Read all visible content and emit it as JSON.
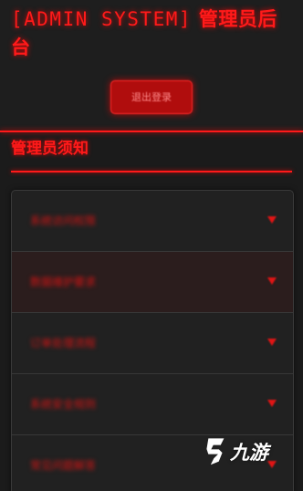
{
  "header": {
    "title_prefix": "[ADMIN SYSTEM]",
    "title_suffix": "管理员后台",
    "logout_label": "退出登录"
  },
  "notice": {
    "section_title": "管理员须知",
    "items": [
      {
        "label": "系统访问权限"
      },
      {
        "label": "数据维护要求"
      },
      {
        "label": "订单处理流程"
      },
      {
        "label": "系统安全规则"
      },
      {
        "label": "常见问题解答"
      }
    ]
  },
  "watermark": {
    "text": "九游",
    "icon": "jiuyou-logo-icon"
  },
  "colors": {
    "accent": "#ff1a1a",
    "background": "#1b1b1b",
    "panel": "#212121",
    "active_row": "#2b1d1d"
  }
}
